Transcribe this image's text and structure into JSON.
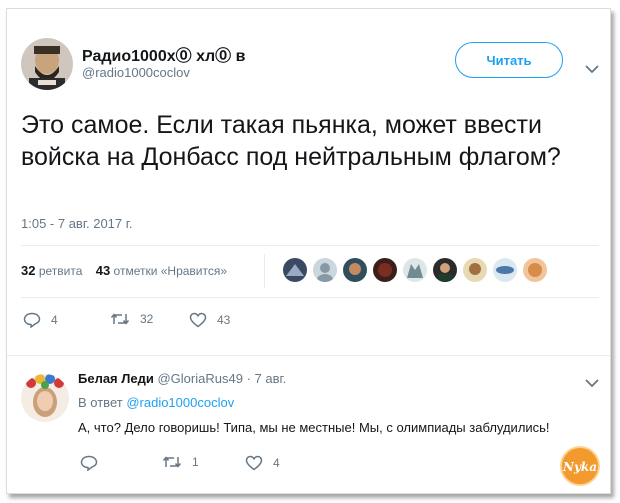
{
  "tweet": {
    "author_name": "Радио1000х⓪ хл⓪ в",
    "author_handle": "@radio1000coclov",
    "follow_label": "Читать",
    "text": "Это самое. Если такая пьянка, может ввести войска на Донбасс под нейтральным флагом?",
    "timestamp": "1:05 - 7 авг. 2017 г.",
    "retweet_count": "32",
    "retweet_label": "ретвита",
    "like_count": "43",
    "like_label": "отметки «Нравится»",
    "actions": {
      "reply": "4",
      "retweet": "32",
      "like": "43"
    }
  },
  "reply": {
    "author_name": "Белая Леди",
    "author_handle": "@GloriaRus49",
    "date": "· 7 авг.",
    "in_reply_prefix": "В ответ",
    "in_reply_handle": "@radio1000coclov",
    "text": "А, что? Дело говоришь! Типа, мы не местные! Мы, с олимпиады заблудились!",
    "actions": {
      "reply": "",
      "retweet": "1",
      "like": "4"
    }
  },
  "watermark": {
    "text": "Nyka"
  },
  "colors": {
    "accent": "#1da1f2",
    "secondary_text": "#657786",
    "primary_text": "#14171a",
    "divider": "#e6ecf0"
  },
  "icons": [
    "chevron-down-icon",
    "reply-icon",
    "retweet-icon",
    "like-icon"
  ]
}
